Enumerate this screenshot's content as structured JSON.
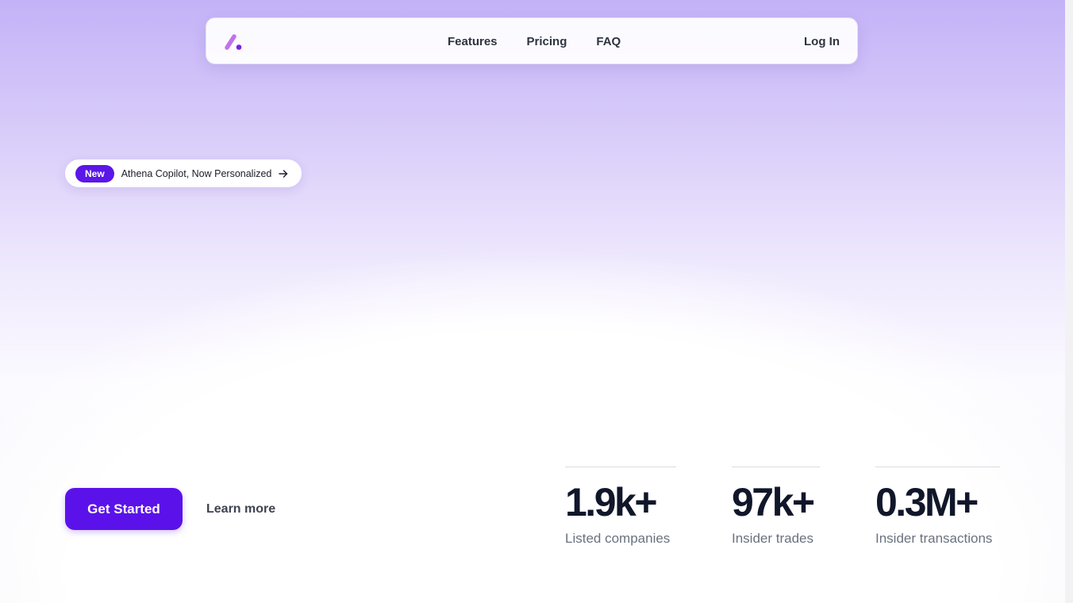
{
  "nav": {
    "logo": "logo-mark",
    "links": [
      "Features",
      "Pricing",
      "FAQ"
    ],
    "login": "Log In"
  },
  "announcement": {
    "badge": "New",
    "text": "Athena Copilot, Now Personalized",
    "icon": "arrow-right-icon"
  },
  "cta": {
    "primary": "Get Started",
    "secondary": "Learn more"
  },
  "stats": [
    {
      "value": "1.9k+",
      "label": "Listed companies"
    },
    {
      "value": "97k+",
      "label": "Insider trades"
    },
    {
      "value": "0.3M+",
      "label": "Insider transactions"
    }
  ],
  "colors": {
    "accent": "#5b12ea",
    "badge": "#5b16e8",
    "logo_light": "#c173e8",
    "logo_dark": "#7b20e6",
    "text_dark": "#11172a",
    "text_muted": "#6a7280"
  }
}
